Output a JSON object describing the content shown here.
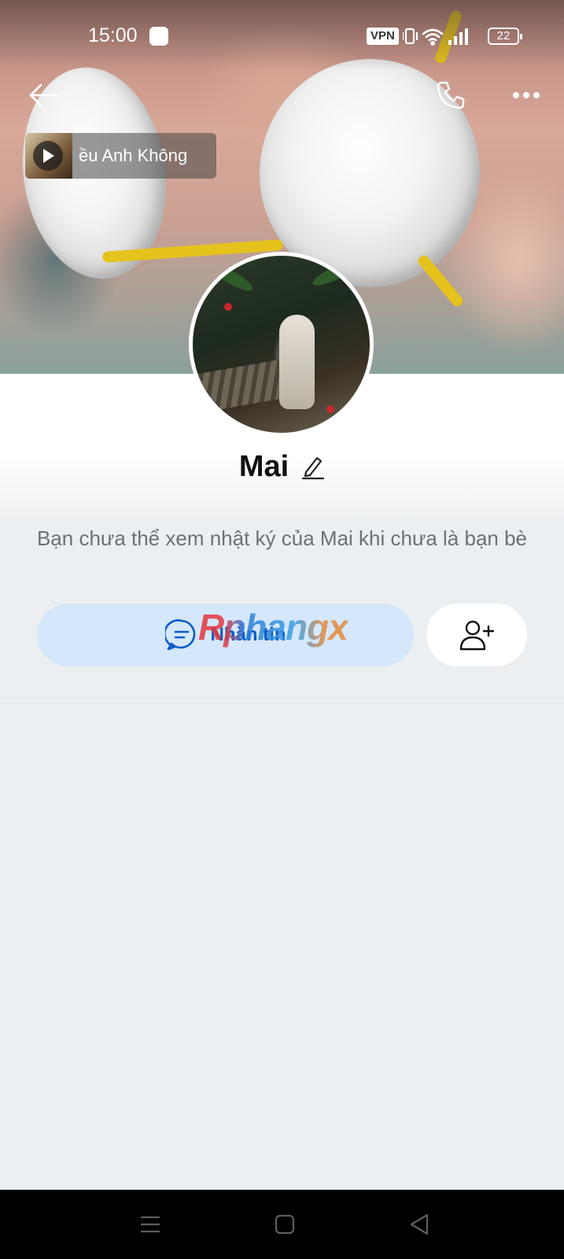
{
  "status_bar": {
    "time": "15:00",
    "vpn_label": "VPN",
    "battery_level": "22",
    "icons": [
      "app-notification-icon",
      "vibrate-icon",
      "wifi-icon",
      "signal-icon",
      "battery-icon"
    ]
  },
  "header": {
    "icons": [
      "back-arrow-icon",
      "phone-icon",
      "more-dots-icon"
    ]
  },
  "music": {
    "title": "ều Anh Không"
  },
  "profile": {
    "name": "Mai",
    "notice": "Bạn chưa thể xem nhật ký của Mai khi chưa là bạn bè"
  },
  "actions": {
    "message_label": "Nhắn tin",
    "watermark": "Rphangx"
  },
  "colors": {
    "message_button_bg": "#d4e7fb",
    "message_text": "#0a5ac7",
    "page_bg": "#eceff1"
  }
}
